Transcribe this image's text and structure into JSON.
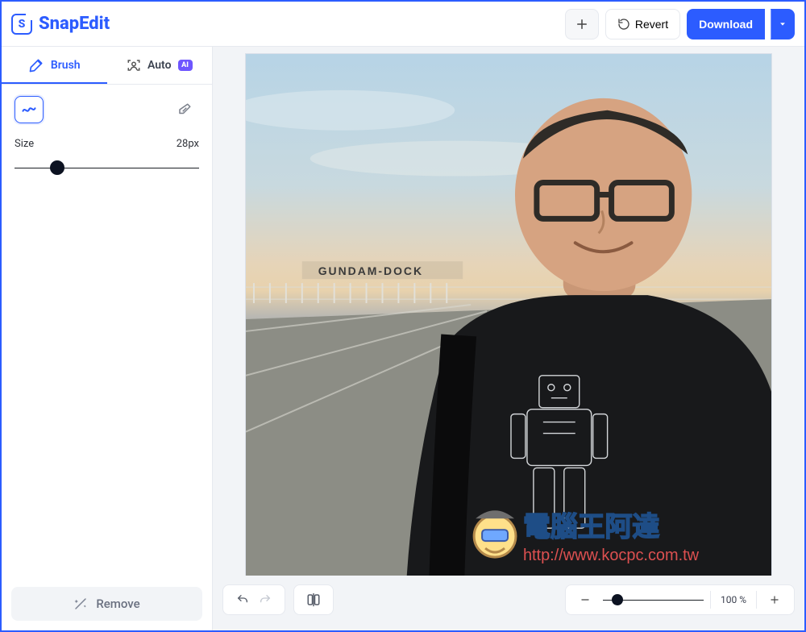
{
  "brand": {
    "name": "SnapEdit",
    "mark": "S"
  },
  "header": {
    "add_tooltip": "+",
    "revert_label": "Revert",
    "download_label": "Download"
  },
  "tabs": {
    "brush": "Brush",
    "auto": "Auto",
    "ai_badge": "AI"
  },
  "brush": {
    "size_label": "Size",
    "size_value_display": "28px",
    "size_value": 28,
    "size_min": 1,
    "size_max": 100,
    "slider_percent": 23
  },
  "actions": {
    "remove_label": "Remove"
  },
  "zoom": {
    "value_display": "100 %",
    "percent": 100,
    "slider_percent": 14
  },
  "watermark": {
    "text": "電腦王阿達",
    "url": "http://www.kocpc.com.tw"
  },
  "image_scene": {
    "description": "Man selfie outdoors at Gundam Dock plaza",
    "sign_text": "GUNDAM-DOCK"
  }
}
